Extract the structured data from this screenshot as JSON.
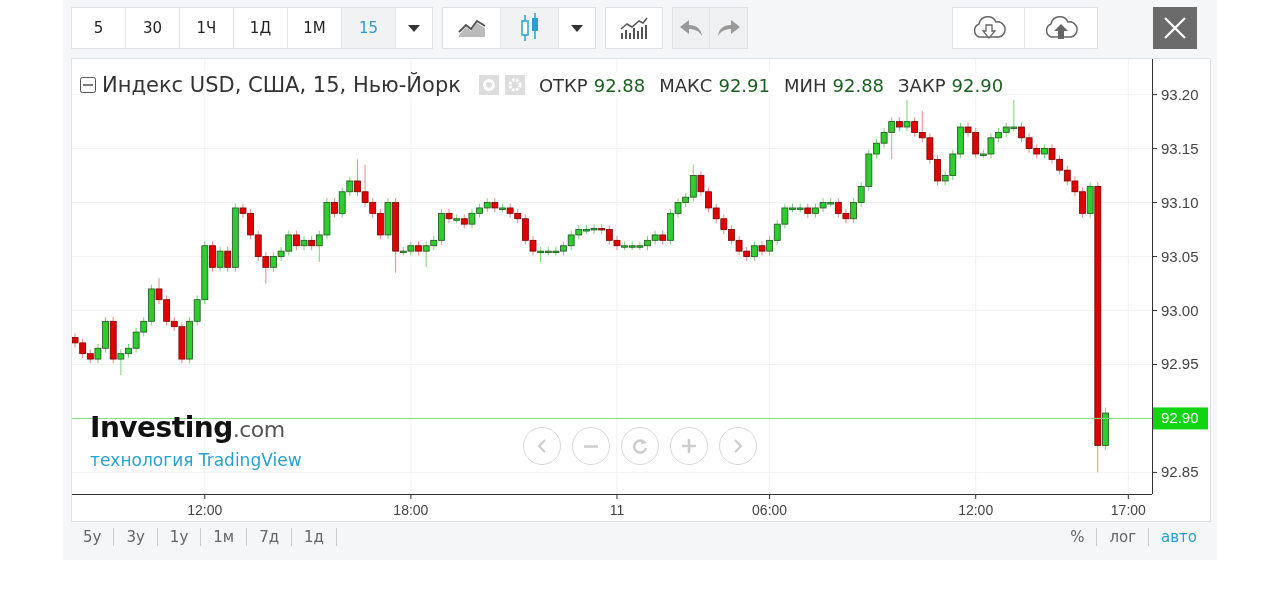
{
  "toolbar": {
    "intervals": [
      {
        "label": "5",
        "selected": false
      },
      {
        "label": "30",
        "selected": false
      },
      {
        "label": "1Ч",
        "selected": false
      },
      {
        "label": "1Д",
        "selected": false
      },
      {
        "label": "1М",
        "selected": false
      },
      {
        "label": "15",
        "selected": true
      }
    ],
    "chart_types": [
      {
        "kind": "line",
        "selected": false
      },
      {
        "kind": "candles",
        "selected": true
      }
    ],
    "history": [
      {
        "kind": "undo",
        "disabled": true
      },
      {
        "kind": "redo",
        "disabled": true
      }
    ]
  },
  "legend": {
    "title": "Индекс USD, США, 15, Нью-Йорк",
    "fields": [
      {
        "label": "ОТКР",
        "value": "92.88"
      },
      {
        "label": "МАКС",
        "value": "92.91"
      },
      {
        "label": "МИН",
        "value": "92.88"
      },
      {
        "label": "ЗАКР",
        "value": "92.90"
      }
    ]
  },
  "watermark": {
    "logo": "**Investing**.com",
    "caption": "технология TradingView"
  },
  "chart_data": {
    "type": "candlestick",
    "grid": true,
    "ylim": [
      92.83,
      93.233
    ],
    "yticks": [
      {
        "value": 92.85,
        "label": "92.85"
      },
      {
        "value": 92.9,
        "label": "92.90"
      },
      {
        "value": 92.95,
        "label": "92.95"
      },
      {
        "value": 93.0,
        "label": "93.00"
      },
      {
        "value": 93.05,
        "label": "93.05"
      },
      {
        "value": 93.1,
        "label": "93.10"
      },
      {
        "value": 93.15,
        "label": "93.15"
      },
      {
        "value": 93.2,
        "label": "93.20"
      }
    ],
    "ref_lines": [
      {
        "axis": "y",
        "value": 92.9
      }
    ],
    "categories": [
      null,
      null,
      null,
      null,
      null,
      null,
      null,
      null,
      null,
      null,
      null,
      null,
      null,
      null,
      null,
      null,
      null,
      "12:00",
      null,
      null,
      null,
      null,
      null,
      null,
      null,
      null,
      null,
      null,
      null,
      null,
      null,
      null,
      null,
      null,
      null,
      null,
      null,
      null,
      null,
      null,
      null,
      null,
      null,
      null,
      "18:00",
      null,
      null,
      null,
      null,
      null,
      null,
      null,
      null,
      null,
      null,
      null,
      null,
      null,
      null,
      null,
      null,
      null,
      null,
      null,
      null,
      null,
      null,
      null,
      null,
      null,
      null,
      "11",
      null,
      null,
      null,
      null,
      null,
      null,
      null,
      null,
      null,
      null,
      null,
      null,
      null,
      null,
      null,
      null,
      null,
      null,
      null,
      "06:00",
      null,
      null,
      null,
      null,
      null,
      null,
      null,
      null,
      null,
      null,
      null,
      null,
      null,
      null,
      null,
      null,
      null,
      null,
      null,
      null,
      null,
      null,
      null,
      null,
      null,
      null,
      "12:00",
      null,
      null,
      null,
      null,
      null,
      null,
      null,
      null,
      null,
      null,
      null,
      null,
      null,
      null,
      null,
      null,
      null,
      null,
      null,
      "17:00"
    ],
    "ohlc": [
      [
        92.975,
        92.979,
        92.966,
        92.97
      ],
      [
        92.97,
        92.974,
        92.956,
        92.96
      ],
      [
        92.96,
        92.964,
        92.951,
        92.955
      ],
      [
        92.955,
        92.969,
        92.951,
        92.965
      ],
      [
        92.965,
        92.994,
        92.961,
        92.99
      ],
      [
        92.99,
        92.994,
        92.951,
        92.955
      ],
      [
        92.955,
        92.964,
        92.94,
        92.96
      ],
      [
        92.96,
        92.969,
        92.956,
        92.965
      ],
      [
        92.965,
        92.984,
        92.961,
        92.98
      ],
      [
        92.98,
        92.994,
        92.976,
        92.99
      ],
      [
        92.99,
        93.024,
        92.986,
        93.02
      ],
      [
        93.02,
        93.03,
        93.006,
        93.01
      ],
      [
        93.01,
        93.014,
        92.986,
        92.99
      ],
      [
        92.99,
        92.994,
        92.981,
        92.985
      ],
      [
        92.985,
        92.989,
        92.951,
        92.955
      ],
      [
        92.955,
        92.994,
        92.951,
        92.99
      ],
      [
        92.99,
        93.014,
        92.986,
        93.01
      ],
      [
        93.01,
        93.064,
        93.006,
        93.06
      ],
      [
        93.06,
        93.064,
        93.036,
        93.04
      ],
      [
        93.04,
        93.059,
        93.036,
        93.055
      ],
      [
        93.055,
        93.059,
        93.036,
        93.04
      ],
      [
        93.04,
        93.099,
        93.036,
        93.095
      ],
      [
        93.095,
        93.099,
        93.086,
        93.09
      ],
      [
        93.09,
        93.094,
        93.066,
        93.07
      ],
      [
        93.07,
        93.074,
        93.046,
        93.05
      ],
      [
        93.05,
        93.054,
        93.025,
        93.04
      ],
      [
        93.04,
        93.054,
        93.036,
        93.05
      ],
      [
        93.05,
        93.059,
        93.046,
        93.055
      ],
      [
        93.055,
        93.074,
        93.051,
        93.07
      ],
      [
        93.07,
        93.074,
        93.056,
        93.06
      ],
      [
        93.06,
        93.069,
        93.056,
        93.065
      ],
      [
        93.065,
        93.069,
        93.056,
        93.06
      ],
      [
        93.06,
        93.074,
        93.045,
        93.07
      ],
      [
        93.07,
        93.104,
        93.066,
        93.1
      ],
      [
        93.1,
        93.104,
        93.086,
        93.09
      ],
      [
        93.09,
        93.114,
        93.086,
        93.11
      ],
      [
        93.11,
        93.124,
        93.106,
        93.12
      ],
      [
        93.12,
        93.14,
        93.106,
        93.11
      ],
      [
        93.11,
        93.135,
        93.096,
        93.1
      ],
      [
        93.1,
        93.104,
        93.086,
        93.09
      ],
      [
        93.09,
        93.094,
        93.066,
        93.07
      ],
      [
        93.07,
        93.104,
        93.066,
        93.1
      ],
      [
        93.1,
        93.104,
        93.035,
        93.055
      ],
      [
        93.055,
        93.059,
        93.051,
        93.055
      ],
      [
        93.055,
        93.064,
        93.051,
        93.06
      ],
      [
        93.06,
        93.064,
        93.051,
        93.055
      ],
      [
        93.055,
        93.064,
        93.04,
        93.06
      ],
      [
        93.06,
        93.069,
        93.056,
        93.065
      ],
      [
        93.065,
        93.094,
        93.061,
        93.09
      ],
      [
        93.09,
        93.094,
        93.081,
        93.085
      ],
      [
        93.085,
        93.089,
        93.081,
        93.085
      ],
      [
        93.085,
        93.089,
        93.076,
        93.08
      ],
      [
        93.08,
        93.094,
        93.076,
        93.09
      ],
      [
        93.09,
        93.099,
        93.086,
        93.095
      ],
      [
        93.095,
        93.104,
        93.091,
        93.1
      ],
      [
        93.1,
        93.104,
        93.091,
        93.095
      ],
      [
        93.095,
        93.099,
        93.091,
        93.095
      ],
      [
        93.095,
        93.099,
        93.086,
        93.09
      ],
      [
        93.09,
        93.094,
        93.081,
        93.085
      ],
      [
        93.085,
        93.089,
        93.061,
        93.065
      ],
      [
        93.065,
        93.069,
        93.051,
        93.055
      ],
      [
        93.055,
        93.059,
        93.045,
        93.055
      ],
      [
        93.055,
        93.059,
        93.051,
        93.055
      ],
      [
        93.055,
        93.059,
        93.051,
        93.055
      ],
      [
        93.055,
        93.064,
        93.051,
        93.06
      ],
      [
        93.06,
        93.074,
        93.056,
        93.07
      ],
      [
        93.07,
        93.079,
        93.066,
        93.075
      ],
      [
        93.075,
        93.079,
        93.071,
        93.075
      ],
      [
        93.075,
        93.08,
        93.071,
        93.076
      ],
      [
        93.076,
        93.08,
        93.071,
        93.075
      ],
      [
        93.075,
        93.079,
        93.061,
        93.065
      ],
      [
        93.065,
        93.069,
        93.056,
        93.06
      ],
      [
        93.06,
        93.064,
        93.056,
        93.06
      ],
      [
        93.06,
        93.064,
        93.056,
        93.06
      ],
      [
        93.06,
        93.064,
        93.056,
        93.06
      ],
      [
        93.06,
        93.069,
        93.056,
        93.065
      ],
      [
        93.065,
        93.074,
        93.061,
        93.07
      ],
      [
        93.07,
        93.074,
        93.061,
        93.065
      ],
      [
        93.065,
        93.094,
        93.061,
        93.09
      ],
      [
        93.09,
        93.104,
        93.086,
        93.1
      ],
      [
        93.1,
        93.109,
        93.096,
        93.105
      ],
      [
        93.105,
        93.135,
        93.101,
        93.125
      ],
      [
        93.125,
        93.129,
        93.106,
        93.11
      ],
      [
        93.11,
        93.114,
        93.091,
        93.095
      ],
      [
        93.095,
        93.099,
        93.081,
        93.085
      ],
      [
        93.085,
        93.089,
        93.071,
        93.075
      ],
      [
        93.075,
        93.079,
        93.061,
        93.065
      ],
      [
        93.065,
        93.069,
        93.051,
        93.055
      ],
      [
        93.055,
        93.059,
        93.046,
        93.05
      ],
      [
        93.05,
        93.064,
        93.046,
        93.06
      ],
      [
        93.06,
        93.064,
        93.051,
        93.055
      ],
      [
        93.055,
        93.069,
        93.051,
        93.065
      ],
      [
        93.065,
        93.084,
        93.061,
        93.08
      ],
      [
        93.08,
        93.099,
        93.076,
        93.095
      ],
      [
        93.095,
        93.099,
        93.091,
        93.095
      ],
      [
        93.095,
        93.099,
        93.091,
        93.095
      ],
      [
        93.095,
        93.099,
        93.086,
        93.09
      ],
      [
        93.09,
        93.099,
        93.086,
        93.095
      ],
      [
        93.095,
        93.104,
        93.091,
        93.1
      ],
      [
        93.1,
        93.104,
        93.096,
        93.1
      ],
      [
        93.1,
        93.104,
        93.086,
        93.09
      ],
      [
        93.09,
        93.094,
        93.081,
        93.085
      ],
      [
        93.085,
        93.104,
        93.081,
        93.1
      ],
      [
        93.1,
        93.119,
        93.096,
        93.115
      ],
      [
        93.115,
        93.149,
        93.111,
        93.145
      ],
      [
        93.145,
        93.159,
        93.141,
        93.155
      ],
      [
        93.155,
        93.169,
        93.151,
        93.165
      ],
      [
        93.165,
        93.179,
        93.14,
        93.175
      ],
      [
        93.175,
        93.179,
        93.166,
        93.17
      ],
      [
        93.17,
        93.195,
        93.166,
        93.175
      ],
      [
        93.175,
        93.179,
        93.161,
        93.165
      ],
      [
        93.165,
        93.185,
        93.156,
        93.16
      ],
      [
        93.16,
        93.164,
        93.136,
        93.14
      ],
      [
        93.14,
        93.144,
        93.116,
        93.12
      ],
      [
        93.12,
        93.129,
        93.116,
        93.125
      ],
      [
        93.125,
        93.149,
        93.121,
        93.145
      ],
      [
        93.145,
        93.174,
        93.141,
        93.17
      ],
      [
        93.17,
        93.174,
        93.161,
        93.165
      ],
      [
        93.165,
        93.169,
        93.141,
        93.145
      ],
      [
        93.145,
        93.149,
        93.141,
        93.145
      ],
      [
        93.145,
        93.164,
        93.141,
        93.16
      ],
      [
        93.16,
        93.169,
        93.156,
        93.165
      ],
      [
        93.165,
        93.174,
        93.161,
        93.17
      ],
      [
        93.17,
        93.195,
        93.166,
        93.17
      ],
      [
        93.17,
        93.174,
        93.156,
        93.16
      ],
      [
        93.16,
        93.164,
        93.146,
        93.15
      ],
      [
        93.15,
        93.154,
        93.141,
        93.145
      ],
      [
        93.145,
        93.154,
        93.141,
        93.15
      ],
      [
        93.15,
        93.154,
        93.136,
        93.14
      ],
      [
        93.14,
        93.144,
        93.126,
        93.13
      ],
      [
        93.13,
        93.134,
        93.116,
        93.12
      ],
      [
        93.12,
        93.124,
        93.106,
        93.11
      ],
      [
        93.11,
        93.114,
        93.086,
        93.09
      ],
      [
        93.09,
        93.119,
        93.086,
        93.115
      ],
      [
        93.115,
        93.119,
        92.85,
        92.875
      ],
      [
        92.875,
        92.91,
        92.871,
        92.905
      ],
      null,
      null,
      null
    ]
  },
  "ranges": [
    {
      "label": "5у"
    },
    {
      "label": "3у"
    },
    {
      "label": "1у"
    },
    {
      "label": "1м"
    },
    {
      "label": "7д"
    },
    {
      "label": "1д"
    }
  ],
  "scale_modes": [
    {
      "label": "%",
      "selected": false
    },
    {
      "label": "лог",
      "selected": false
    },
    {
      "label": "авто",
      "selected": true
    }
  ]
}
